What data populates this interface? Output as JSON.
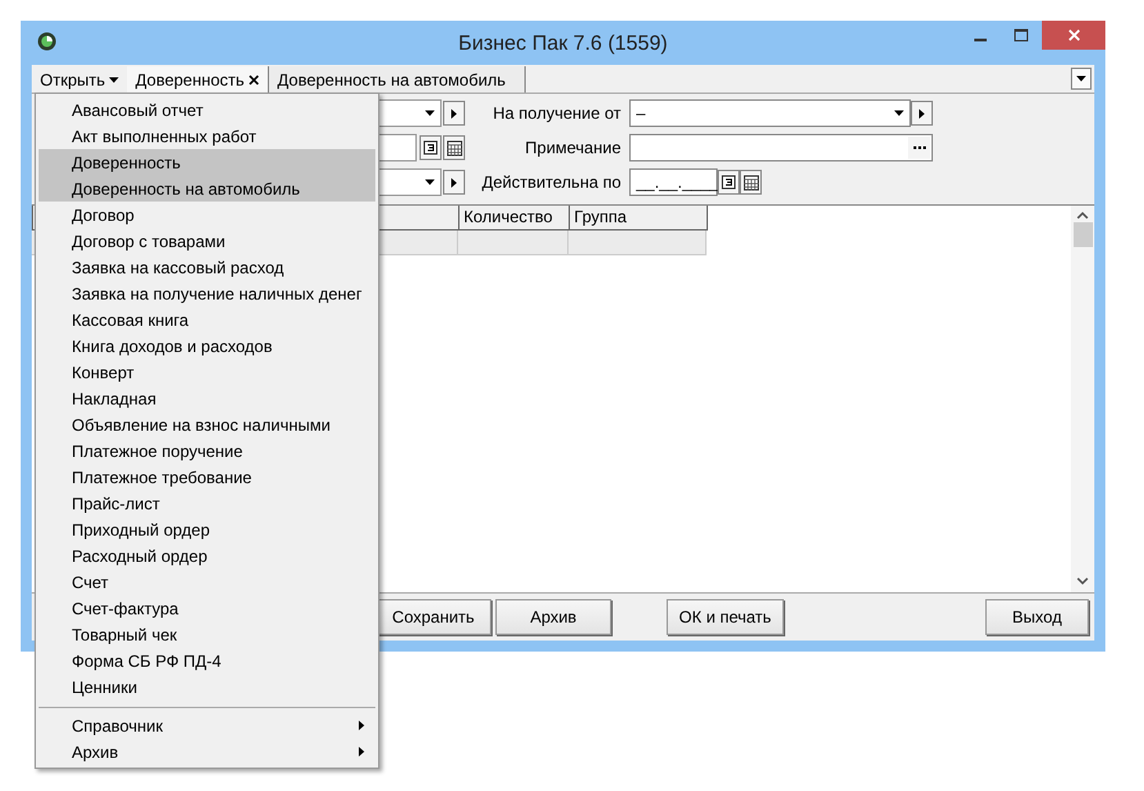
{
  "window": {
    "title": "Бизнес Пак 7.6 (1559)"
  },
  "open_button": {
    "label": "Открыть"
  },
  "tabs": [
    {
      "label": "Доверенность",
      "kind": "closable",
      "selected": true
    },
    {
      "label": "Доверенность на автомобиль",
      "kind": "plain",
      "selected": false
    }
  ],
  "form": [
    {
      "label": "На получение от",
      "field": {
        "kind": "combo",
        "value": "–"
      }
    },
    {
      "label": "Примечание",
      "field": {
        "kind": "text"
      }
    },
    {
      "label": "Действительна по",
      "field": {
        "kind": "date",
        "value": "__.__.____"
      }
    }
  ],
  "table": {
    "columns": [
      "Количество",
      "Группа"
    ]
  },
  "buttons": [
    "Сохранить",
    "Архив",
    "ОК и печать",
    "Выход"
  ],
  "menu": {
    "items": [
      {
        "label": "Авансовый отчет",
        "selected": false
      },
      {
        "label": "Акт выполненных работ",
        "selected": false
      },
      {
        "label": "Доверенность",
        "selected": true
      },
      {
        "label": "Доверенность на автомобиль",
        "selected": true
      },
      {
        "label": "Договор",
        "selected": false
      },
      {
        "label": "Договор с товарами",
        "selected": false
      },
      {
        "label": "Заявка на кассовый расход",
        "selected": false
      },
      {
        "label": "Заявка на получение наличных денег",
        "selected": false
      },
      {
        "label": "Кассовая книга",
        "selected": false
      },
      {
        "label": "Книга доходов и расходов",
        "selected": false
      },
      {
        "label": "Конверт",
        "selected": false
      },
      {
        "label": "Накладная",
        "selected": false
      },
      {
        "label": "Объявление на взнос наличными",
        "selected": false
      },
      {
        "label": "Платежное поручение",
        "selected": false
      },
      {
        "label": "Платежное требование",
        "selected": false
      },
      {
        "label": "Прайс-лист",
        "selected": false
      },
      {
        "label": "Приходный ордер",
        "selected": false
      },
      {
        "label": "Расходный ордер",
        "selected": false
      },
      {
        "label": "Счет",
        "selected": false
      },
      {
        "label": "Счет-фактура",
        "selected": false
      },
      {
        "label": "Товарный чек",
        "selected": false
      },
      {
        "label": "Форма СБ РФ ПД-4",
        "selected": false
      },
      {
        "label": "Ценники",
        "selected": false
      }
    ],
    "submenus": [
      "Справочник",
      "Архив"
    ]
  }
}
